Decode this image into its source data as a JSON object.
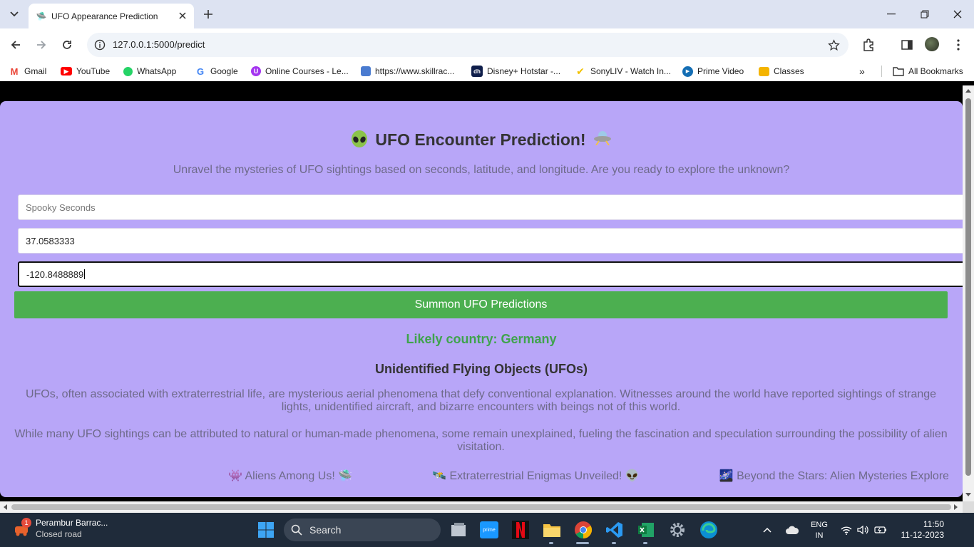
{
  "browser": {
    "tab_title": "UFO Appearance Prediction",
    "url": "127.0.0.1:5000/predict",
    "bookmarks": [
      {
        "label": "Gmail",
        "icon": "gmail-icon",
        "color": "#ea4335"
      },
      {
        "label": "YouTube",
        "icon": "youtube-icon",
        "color": "#ff0000"
      },
      {
        "label": "WhatsApp",
        "icon": "whatsapp-icon",
        "color": "#25d366"
      },
      {
        "label": "Google",
        "icon": "google-icon",
        "color": "#4285f4"
      },
      {
        "label": "Online Courses - Le...",
        "icon": "udemy-icon",
        "color": "#a435f0"
      },
      {
        "label": "https://www.skillrac...",
        "icon": "skillrack-icon",
        "color": "#4a7bd0"
      },
      {
        "label": "Disney+ Hotstar -...",
        "icon": "hotstar-icon",
        "color": "#0f1e4a"
      },
      {
        "label": "SonyLIV - Watch In...",
        "icon": "sonyliv-icon",
        "color": "#f2c200"
      },
      {
        "label": "Prime Video",
        "icon": "prime-video-icon",
        "color": "#146eb4"
      },
      {
        "label": "Classes",
        "icon": "classroom-icon",
        "color": "#f4b400"
      }
    ],
    "all_bookmarks_label": "All Bookmarks"
  },
  "page": {
    "heading": "UFO Encounter Prediction!",
    "subtitle": "Unravel the mysteries of UFO sightings based on seconds, latitude, and longitude. Are you ready to explore the unknown?",
    "seconds_placeholder": "Spooky Seconds",
    "latitude_value": "37.0583333",
    "longitude_value": "-120.8488889",
    "submit_label": "Summon UFO Predictions",
    "result": "Likely country: Germany",
    "section_title": "Unidentified Flying Objects (UFOs)",
    "para1": "UFOs, often associated with extraterrestrial life, are mysterious aerial phenomena that defy conventional explanation. Witnesses around the world have reported sightings of strange lights, unidentified aircraft, and bizarre encounters with beings not of this world.",
    "para2": "While many UFO sightings can be attributed to natural or human-made phenomena, some remain unexplained, fueling the fascination and speculation surrounding the possibility of alien visitation.",
    "ticker": [
      "👾 Aliens Among Us! 🛸",
      "🛰️ Extraterrestrial Enigmas Unveiled! 👽",
      "🌌 Beyond the Stars: Alien Mysteries Explored"
    ],
    "colors": {
      "card_bg": "#b8a6f8",
      "button_bg": "#4caf50",
      "result_color": "#3fa34d"
    }
  },
  "taskbar": {
    "weather_title": "Perambur Barrac...",
    "weather_sub": "Closed road",
    "weather_badge": "1",
    "search_label": "Search",
    "lang_line1": "ENG",
    "lang_line2": "IN",
    "time": "11:50",
    "date": "11-12-2023"
  }
}
